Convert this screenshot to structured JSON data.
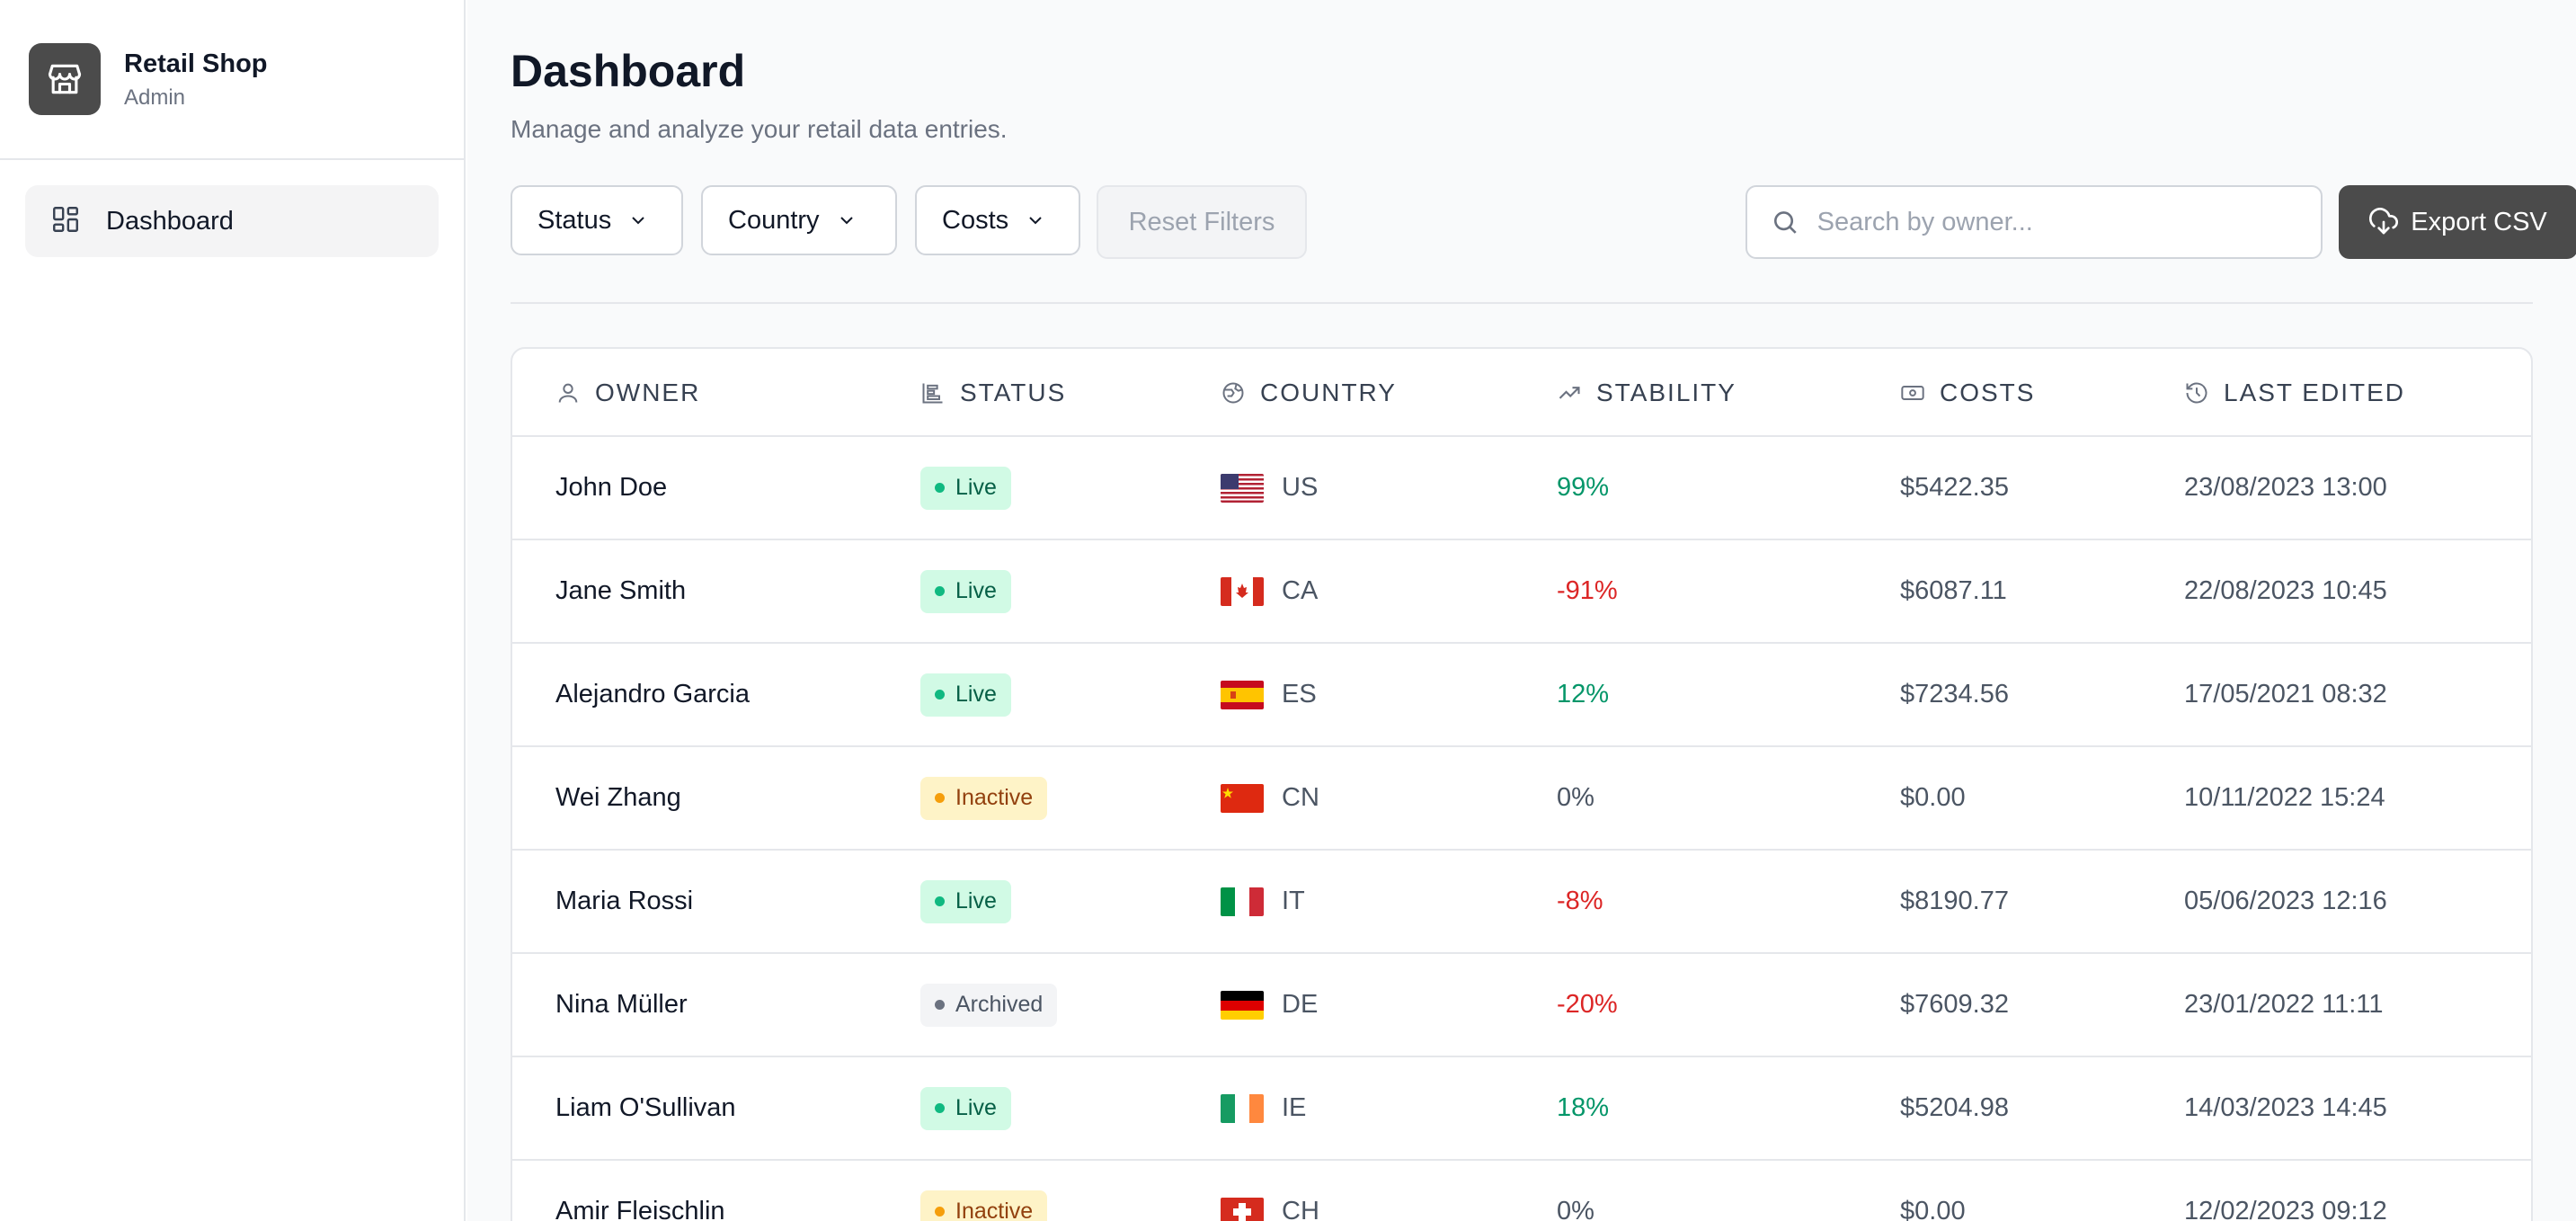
{
  "sidebar": {
    "brand_title": "Retail Shop",
    "brand_subtitle": "Admin",
    "nav_items": [
      {
        "label": "Dashboard",
        "icon": "dashboard-grid-icon"
      }
    ]
  },
  "header": {
    "title": "Dashboard",
    "subtitle": "Manage and analyze your retail data entries."
  },
  "toolbar": {
    "filters": [
      "Status",
      "Country",
      "Costs"
    ],
    "reset_label": "Reset Filters",
    "search_placeholder": "Search by owner...",
    "export_label": "Export CSV"
  },
  "table": {
    "columns": [
      "OWNER",
      "STATUS",
      "COUNTRY",
      "STABILITY",
      "COSTS",
      "LAST EDITED"
    ],
    "rows": [
      {
        "owner": "John Doe",
        "status": "Live",
        "country": "US",
        "stability": "99%",
        "costs": "$5422.35",
        "edited": "23/08/2023 13:00"
      },
      {
        "owner": "Jane Smith",
        "status": "Live",
        "country": "CA",
        "stability": "-91%",
        "costs": "$6087.11",
        "edited": "22/08/2023 10:45"
      },
      {
        "owner": "Alejandro Garcia",
        "status": "Live",
        "country": "ES",
        "stability": "12%",
        "costs": "$7234.56",
        "edited": "17/05/2021 08:32"
      },
      {
        "owner": "Wei Zhang",
        "status": "Inactive",
        "country": "CN",
        "stability": "0%",
        "costs": "$0.00",
        "edited": "10/11/2022 15:24"
      },
      {
        "owner": "Maria Rossi",
        "status": "Live",
        "country": "IT",
        "stability": "-8%",
        "costs": "$8190.77",
        "edited": "05/06/2023 12:16"
      },
      {
        "owner": "Nina Müller",
        "status": "Archived",
        "country": "DE",
        "stability": "-20%",
        "costs": "$7609.32",
        "edited": "23/01/2022 11:11"
      },
      {
        "owner": "Liam O'Sullivan",
        "status": "Live",
        "country": "IE",
        "stability": "18%",
        "costs": "$5204.98",
        "edited": "14/03/2023 14:45"
      },
      {
        "owner": "Amir Fleischlin",
        "status": "Inactive",
        "country": "CH",
        "stability": "0%",
        "costs": "$0.00",
        "edited": "12/02/2023 09:12"
      }
    ]
  },
  "colors": {
    "accent_dark": "#4b4b4b",
    "positive": "#059669",
    "negative": "#dc2626",
    "live_bg": "#d1fae5",
    "inactive_bg": "#fef3c7",
    "archived_bg": "#f3f4f6"
  }
}
